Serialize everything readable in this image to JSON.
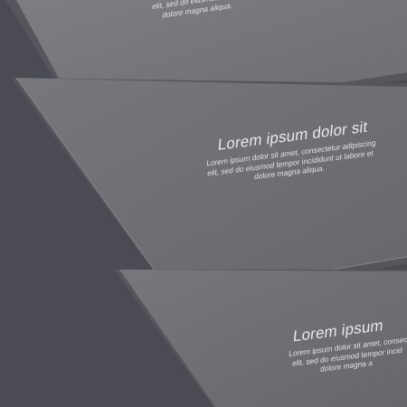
{
  "colors": {
    "background": "#4b4b53",
    "card": "#6d6d72",
    "card_edge": "#85858a",
    "shadow": "#5b5b62",
    "text": "#e9e9ec"
  },
  "cards": [
    {
      "title": "",
      "body": "elit, sed do eiusmod tempor\ndolore magna aliqua."
    },
    {
      "title": "Lorem ipsum dolor sit",
      "body": "Lorem ipsum dolor sit amet, consectetur adipiscing\nelit, sed do eiusmod tempor incididunt ut labore et\ndolore magna aliqua."
    },
    {
      "title": "Lorem ipsum",
      "body": "Lorem ipsum dolor sit amet, consec\nelit, sed do eiusmod tempor incid\ndolore magna a"
    }
  ]
}
